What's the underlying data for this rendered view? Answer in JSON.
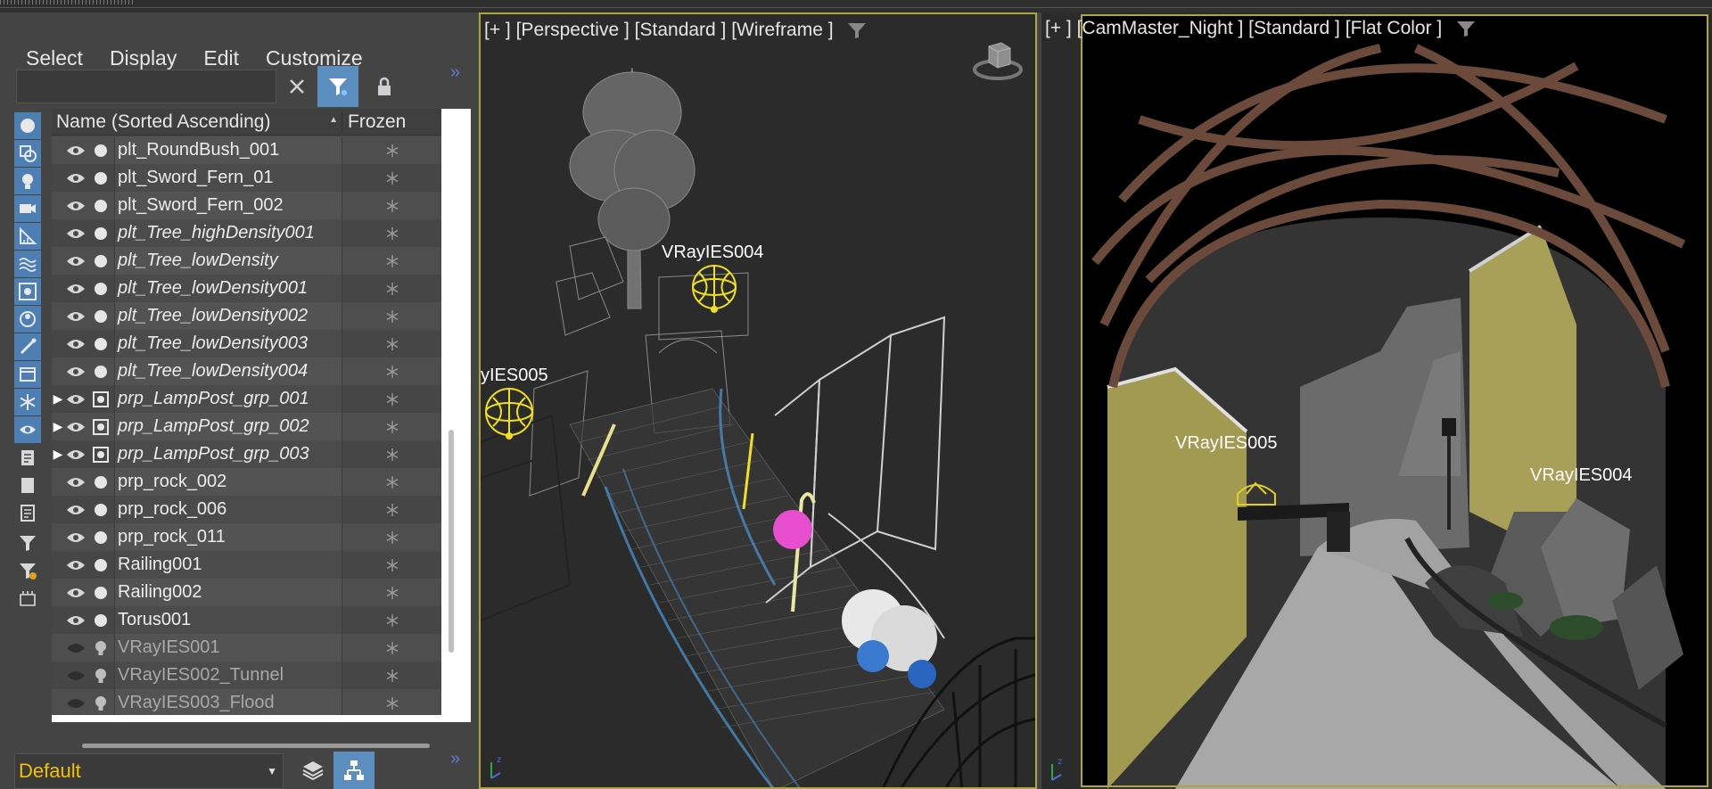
{
  "menu": [
    "Select",
    "Display",
    "Edit",
    "Customize"
  ],
  "toolbar": {
    "search_placeholder": "",
    "clear_icon": "close-icon",
    "filter_icon": "filter-icon",
    "lock_icon": "lock-icon",
    "expand": "»"
  },
  "explorer": {
    "columns": {
      "name": "Name (Sorted Ascending)",
      "frozen": "Frozen"
    },
    "rows": [
      {
        "name": "plt_RoundBush_001",
        "italic": false,
        "expandable": false,
        "type": "geometry",
        "visible": true
      },
      {
        "name": "plt_Sword_Fern_01",
        "italic": false,
        "expandable": false,
        "type": "geometry",
        "visible": true
      },
      {
        "name": "plt_Sword_Fern_002",
        "italic": false,
        "expandable": false,
        "type": "geometry",
        "visible": true
      },
      {
        "name": "plt_Tree_highDensity001",
        "italic": true,
        "expandable": false,
        "type": "geometry",
        "visible": true
      },
      {
        "name": "plt_Tree_lowDensity",
        "italic": true,
        "expandable": false,
        "type": "geometry",
        "visible": true
      },
      {
        "name": "plt_Tree_lowDensity001",
        "italic": true,
        "expandable": false,
        "type": "geometry",
        "visible": true
      },
      {
        "name": "plt_Tree_lowDensity002",
        "italic": true,
        "expandable": false,
        "type": "geometry",
        "visible": true
      },
      {
        "name": "plt_Tree_lowDensity003",
        "italic": true,
        "expandable": false,
        "type": "geometry",
        "visible": true
      },
      {
        "name": "plt_Tree_lowDensity004",
        "italic": true,
        "expandable": false,
        "type": "geometry",
        "visible": true
      },
      {
        "name": "prp_LampPost_grp_001",
        "italic": true,
        "expandable": true,
        "type": "group",
        "visible": true
      },
      {
        "name": "prp_LampPost_grp_002",
        "italic": true,
        "expandable": true,
        "type": "group",
        "visible": true
      },
      {
        "name": "prp_LampPost_grp_003",
        "italic": true,
        "expandable": true,
        "type": "group",
        "visible": true
      },
      {
        "name": "prp_rock_002",
        "italic": false,
        "expandable": false,
        "type": "geometry",
        "visible": true
      },
      {
        "name": "prp_rock_006",
        "italic": false,
        "expandable": false,
        "type": "geometry",
        "visible": true
      },
      {
        "name": "prp_rock_011",
        "italic": false,
        "expandable": false,
        "type": "geometry",
        "visible": true
      },
      {
        "name": "Railing001",
        "italic": false,
        "expandable": false,
        "type": "geometry",
        "visible": true
      },
      {
        "name": "Railing002",
        "italic": false,
        "expandable": false,
        "type": "geometry",
        "visible": true
      },
      {
        "name": "Torus001",
        "italic": false,
        "expandable": false,
        "type": "geometry",
        "visible": true
      },
      {
        "name": "VRayIES001",
        "italic": false,
        "expandable": false,
        "type": "light",
        "visible": false
      },
      {
        "name": "VRayIES002_Tunnel",
        "italic": false,
        "expandable": false,
        "type": "light",
        "visible": false
      },
      {
        "name": "VRayIES003_Flood",
        "italic": false,
        "expandable": false,
        "type": "light",
        "visible": false
      }
    ]
  },
  "layer": {
    "value": "Default"
  },
  "viewport_left": {
    "label": "[+ ] [Perspective ] [Standard ] [Wireframe ]",
    "lights": [
      "VRayIES004",
      "yIES005"
    ]
  },
  "viewport_right": {
    "label": "[+ ] [CamMaster_Night ] [Standard ] [Flat Color ]",
    "lights": [
      "VRayIES005",
      "VRayIES004"
    ]
  },
  "colors": {
    "accent": "#5c8fc0",
    "active_border": "#b0a640",
    "layer_text": "#f2c200"
  }
}
